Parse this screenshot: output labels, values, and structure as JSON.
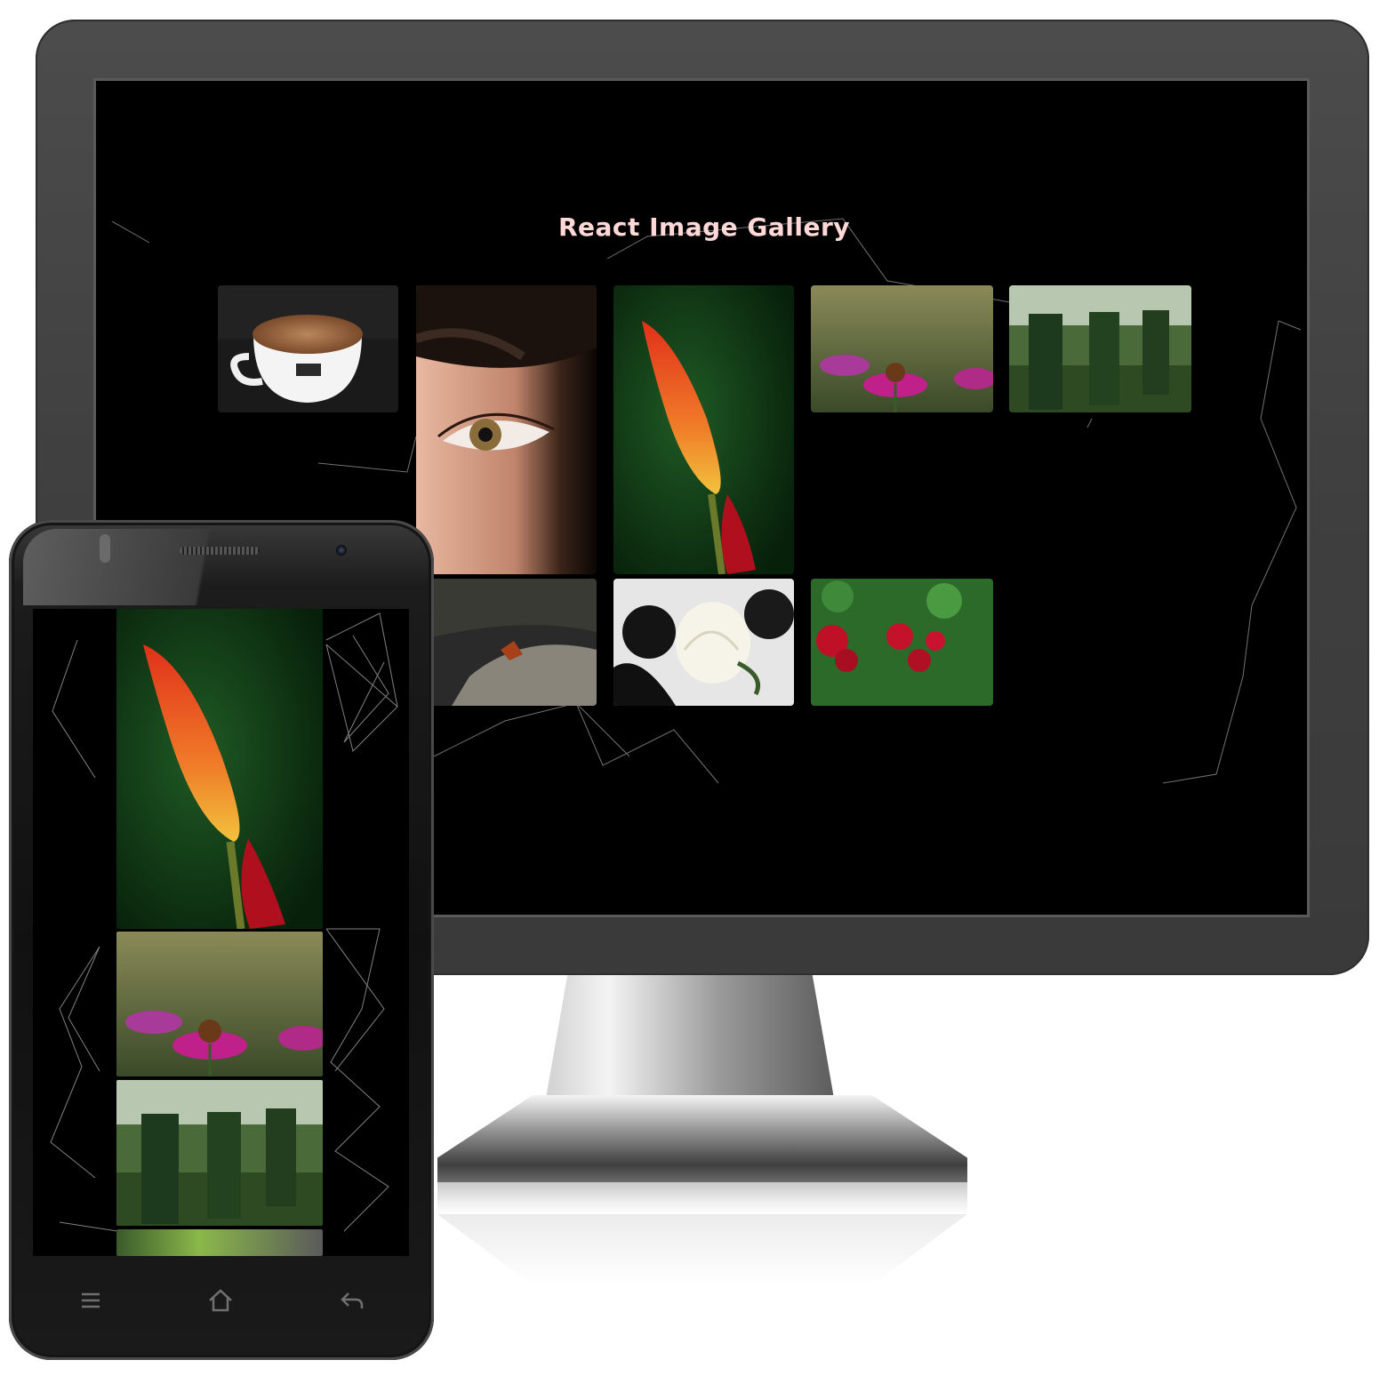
{
  "gallery": {
    "title": "React Image Gallery"
  },
  "desktop_images": [
    {
      "name": "coffee-cup-image",
      "subject": "coffee cup"
    },
    {
      "name": "eye-closeup-image",
      "subject": "eye close-up"
    },
    {
      "name": "red-hot-poker-flower-image",
      "subject": "red hot poker flower"
    },
    {
      "name": "coneflower-image",
      "subject": "purple coneflowers"
    },
    {
      "name": "forest-pillars-image",
      "subject": "forest with stone pillars"
    },
    {
      "name": "butterfly-on-rock-image",
      "subject": "butterfly on rock"
    },
    {
      "name": "white-rose-image",
      "subject": "white rose"
    },
    {
      "name": "red-roses-bush-image",
      "subject": "red roses bush"
    }
  ],
  "mobile_images": [
    {
      "name": "red-hot-poker-flower-image",
      "subject": "red hot poker flower"
    },
    {
      "name": "coneflower-image",
      "subject": "purple coneflowers"
    },
    {
      "name": "forest-pillars-image",
      "subject": "forest with stone pillars"
    },
    {
      "name": "partial-next-image",
      "subject": "partially visible image"
    }
  ],
  "phone_nav": {
    "icons": [
      "menu-icon",
      "home-icon",
      "back-icon"
    ]
  },
  "colors": {
    "background": "#000000",
    "title": "#ffd8d8",
    "bezel": "#444444",
    "web_lines": "#bbbbbb"
  }
}
